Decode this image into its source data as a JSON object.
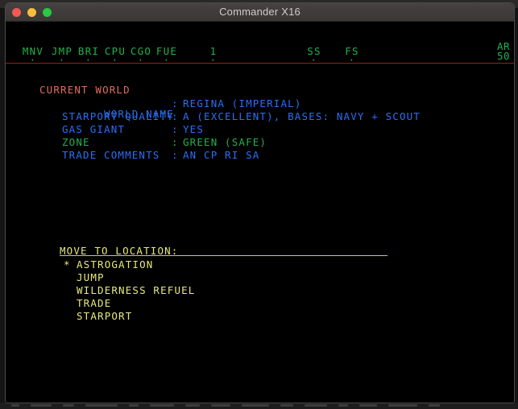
{
  "window": {
    "title": "Commander X16",
    "traffic_lights": [
      {
        "name": "close",
        "color": "#f35952"
      },
      {
        "name": "minimize",
        "color": "#f6bc3c"
      },
      {
        "name": "zoom",
        "color": "#27ca41"
      }
    ]
  },
  "status_bar": {
    "indicators": [
      {
        "label": "MNV",
        "dot": "·"
      },
      {
        "label": "JMP",
        "dot": "·"
      },
      {
        "label": "BRI",
        "dot": "·"
      },
      {
        "label": "CPU",
        "dot": "·"
      },
      {
        "label": "CGO",
        "dot": "·"
      },
      {
        "label": "FUE",
        "dot": "·"
      },
      {
        "label": "1",
        "dot": "·"
      },
      {
        "label": "SS",
        "dot": "·"
      },
      {
        "label": "FS",
        "dot": "·"
      }
    ],
    "right_block": {
      "line1": "AR",
      "line2": "50"
    },
    "color": "#22b14c",
    "rule_color": "#a01c18"
  },
  "current_world": {
    "heading": "CURRENT WORLD",
    "heading_color": "#e06c5e",
    "rows": [
      {
        "label": "WORLD NAME",
        "separator": ":",
        "value": "REGINA (IMPERIAL)",
        "color": "#2a6ff5"
      },
      {
        "label": "STARPORT QUALITY",
        "separator": ":",
        "value": "A (EXCELLENT), BASES: NAVY + SCOUT",
        "color": "#2a6ff5"
      },
      {
        "label": "GAS GIANT",
        "separator": ":",
        "value": "YES",
        "color": "#2a6ff5"
      },
      {
        "label": "ZONE",
        "separator": ":",
        "value": "GREEN (SAFE)",
        "color": "#22b14c"
      },
      {
        "label": "TRADE COMMENTS",
        "separator": ":",
        "value": "AN CP RI SA",
        "color": "#2a6ff5"
      }
    ]
  },
  "menu": {
    "title": "MOVE TO LOCATION:",
    "color": "#e8e87a",
    "cursor_glyph": "*",
    "selected_index": 0,
    "items": [
      {
        "label": "ASTROGATION"
      },
      {
        "label": "JUMP"
      },
      {
        "label": "WILDERNESS REFUEL"
      },
      {
        "label": "TRADE"
      },
      {
        "label": "STARPORT"
      }
    ]
  }
}
